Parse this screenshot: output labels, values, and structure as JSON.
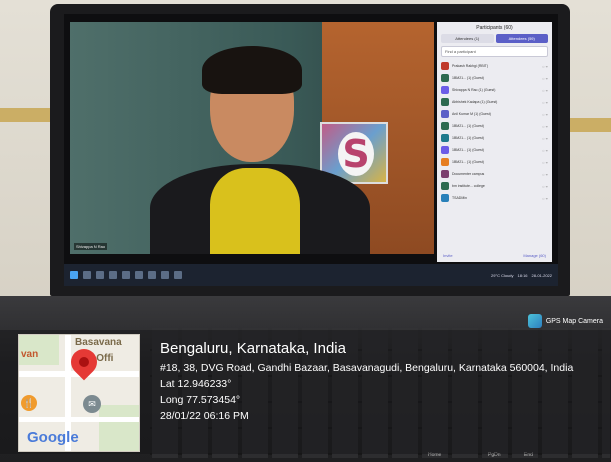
{
  "meeting": {
    "panel_title": "Participants (60)",
    "tabs": [
      "Attendees (1)",
      "Attendees (59)"
    ],
    "search_placeholder": "Find a participant",
    "participants": [
      {
        "name": "Prakash Rakhgi (RBIT)",
        "color": "#c0392b"
      },
      {
        "name": "1BM21... (1) (Guest)",
        "color": "#2d6a4f"
      },
      {
        "name": "Shivappa N Rao (1) (Guest)",
        "color": "#6c5ce7"
      },
      {
        "name": "Abhishek Kadapa (1) (Guest)",
        "color": "#2d6a4f"
      },
      {
        "name": "Anil Kumar M (1) (Guest)",
        "color": "#5b5fc7"
      },
      {
        "name": "1BM21... (1) (Guest)",
        "color": "#2d6a4f"
      },
      {
        "name": "1BM21... (1) (Guest)",
        "color": "#1e7a8c"
      },
      {
        "name": "1BM21... (1) (Guest)",
        "color": "#6c5ce7"
      },
      {
        "name": "1BM21... (1) (Guest)",
        "color": "#e67e22"
      },
      {
        "name": "Documenter campus",
        "color": "#7b3f6e"
      },
      {
        "name": "bm institute... college",
        "color": "#2d6a4f"
      },
      {
        "name": "TSADMin",
        "color": "#2980b9"
      }
    ],
    "footer_left": "Invite",
    "footer_right": "Manage (60)",
    "self_label": "Shivappa N Rao",
    "poster_letter": "S",
    "tray": {
      "weather": "29°C Cloudy",
      "time": "18:16",
      "date": "28-01-2022"
    }
  },
  "gps_app": "GPS Map Camera",
  "location": {
    "title": "Bengaluru, Karnataka, India",
    "address": "#18, 38, DVG Road, Gandhi Bazaar, Basavanagudi, Bengaluru, Karnataka 560004, India",
    "lat": "Lat 12.946233°",
    "long": "Long 77.573454°",
    "datetime": "28/01/22 06:16 PM"
  },
  "map": {
    "area_label": "Basavana",
    "left_label": "van",
    "poi_label": "est Offi",
    "logo": "Google"
  },
  "keyboard": {
    "keys": [
      "Home",
      "PgDn",
      "End"
    ]
  }
}
